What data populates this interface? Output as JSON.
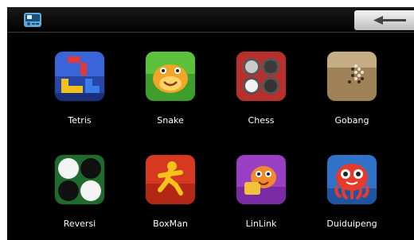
{
  "topbar": {
    "left_icon": "phone-device-icon",
    "back_icon": "arrow-left-icon"
  },
  "colors": {
    "screen_bg": "#000000",
    "label_text": "#ffffff",
    "back_button": "#d9d9d9"
  },
  "apps": [
    {
      "label": "Tetris",
      "icon": "tetris-icon"
    },
    {
      "label": "Snake",
      "icon": "snake-icon"
    },
    {
      "label": "Chess",
      "icon": "chess-icon"
    },
    {
      "label": "Gobang",
      "icon": "gobang-icon"
    },
    {
      "label": "Reversi",
      "icon": "reversi-icon"
    },
    {
      "label": "BoxMan",
      "icon": "boxman-icon"
    },
    {
      "label": "LinLink",
      "icon": "linlink-icon"
    },
    {
      "label": "Duiduipeng",
      "icon": "duiduipeng-icon"
    }
  ]
}
